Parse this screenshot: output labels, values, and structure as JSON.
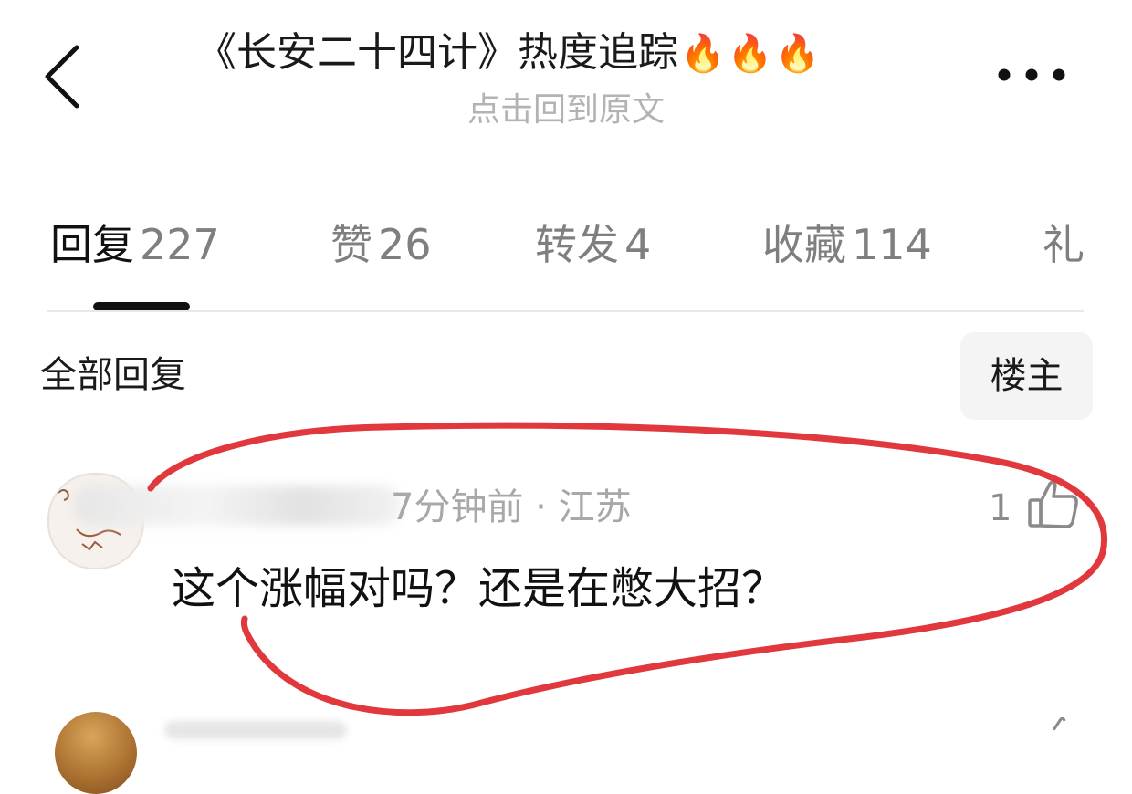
{
  "header": {
    "back_icon": "chevron-left-icon",
    "title": "《长安二十四计》热度追踪",
    "title_emoji": [
      "🔥",
      "🔥",
      "🔥"
    ],
    "subtitle": "点击回到原文",
    "more_icon": "more-horizontal-icon"
  },
  "tabs": [
    {
      "label": "回复",
      "count": "227",
      "active": true
    },
    {
      "label": "赞",
      "count": "26",
      "active": false
    },
    {
      "label": "转发",
      "count": "4",
      "active": false
    },
    {
      "label": "收藏",
      "count": "114",
      "active": false
    },
    {
      "label": "礼",
      "count": "",
      "active": false
    }
  ],
  "replies": {
    "section_title": "全部回复",
    "owner_filter": "楼主"
  },
  "comment": {
    "meta": "7分钟前 · 江苏",
    "like_count": "1",
    "like_icon": "thumbs-up-icon",
    "text": "这个涨幅对吗？还是在憋大招？"
  },
  "colors": {
    "annotation_stroke": "#e0383c",
    "tab_active": "#111111",
    "tab_inactive": "#7f7f7f",
    "muted_text": "#a8a8a8"
  }
}
